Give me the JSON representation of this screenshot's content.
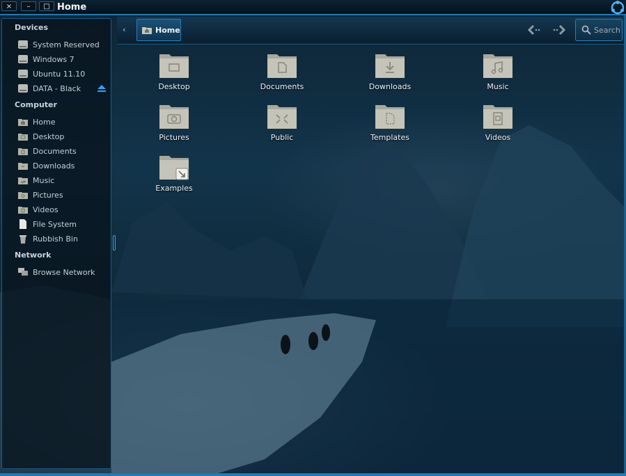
{
  "window": {
    "title": "Home",
    "close": "×",
    "minimize": "–",
    "maximize": "□"
  },
  "sidebar": {
    "devices_heading": "Devices",
    "devices": [
      {
        "label": "System Reserved",
        "icon": "drive-icon"
      },
      {
        "label": "Windows 7",
        "icon": "drive-icon"
      },
      {
        "label": "Ubuntu 11.10",
        "icon": "drive-icon"
      },
      {
        "label": "DATA - Black",
        "icon": "drive-icon"
      }
    ],
    "computer_heading": "Computer",
    "computer": [
      {
        "label": "Home",
        "icon": "home-folder-icon"
      },
      {
        "label": "Desktop",
        "icon": "folder-icon"
      },
      {
        "label": "Documents",
        "icon": "folder-icon"
      },
      {
        "label": "Downloads",
        "icon": "folder-icon"
      },
      {
        "label": "Music",
        "icon": "folder-icon"
      },
      {
        "label": "Pictures",
        "icon": "folder-icon"
      },
      {
        "label": "Videos",
        "icon": "folder-icon"
      },
      {
        "label": "File System",
        "icon": "file-icon"
      },
      {
        "label": "Rubbish Bin",
        "icon": "trash-icon"
      }
    ],
    "network_heading": "Network",
    "network": [
      {
        "label": "Browse Network",
        "icon": "network-icon"
      }
    ]
  },
  "toolbar": {
    "breadcrumb": "Home",
    "search_label": "Search"
  },
  "folders": [
    {
      "label": "Desktop",
      "emblem": "desktop"
    },
    {
      "label": "Documents",
      "emblem": "documents"
    },
    {
      "label": "Downloads",
      "emblem": "downloads"
    },
    {
      "label": "Music",
      "emblem": "music"
    },
    {
      "label": "Pictures",
      "emblem": "pictures"
    },
    {
      "label": "Public",
      "emblem": "public"
    },
    {
      "label": "Templates",
      "emblem": "templates"
    },
    {
      "label": "Videos",
      "emblem": "videos"
    },
    {
      "label": "Examples",
      "emblem": "link"
    }
  ],
  "colors": {
    "accent": "#1c7bb8",
    "folder": "#b8b8ae"
  }
}
